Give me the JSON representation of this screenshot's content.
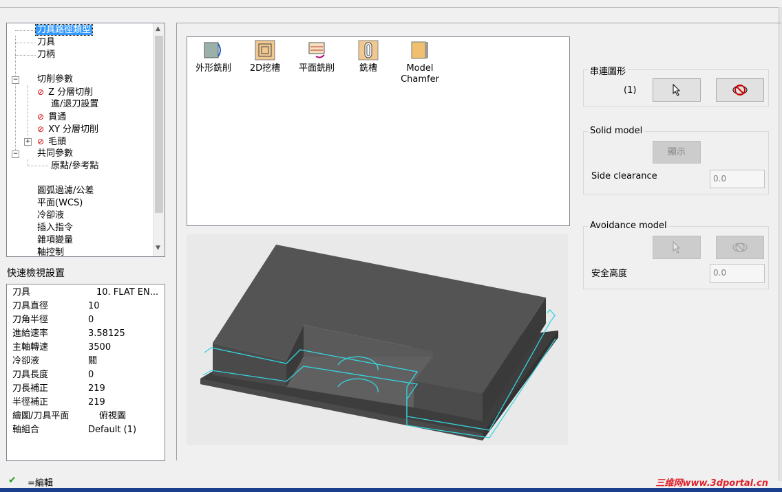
{
  "tree": {
    "items": [
      {
        "label": "刀具路徑類型",
        "selected": true
      },
      {
        "label": "刀具"
      },
      {
        "label": "刀柄"
      },
      {
        "label": "切削參數"
      },
      {
        "label": "Z 分層切削"
      },
      {
        "label": "進/退刀設置"
      },
      {
        "label": "貫通"
      },
      {
        "label": "XY 分層切削"
      },
      {
        "label": "毛頭"
      },
      {
        "label": "共同參數"
      },
      {
        "label": "原點/參考點"
      },
      {
        "label": "圓弧過濾/公差"
      },
      {
        "label": "平面(WCS)"
      },
      {
        "label": "冷卻液"
      },
      {
        "label": "插入指令"
      },
      {
        "label": "雜項變量"
      },
      {
        "label": "軸控制"
      }
    ]
  },
  "quick_view": {
    "title": "快速檢視設置",
    "rows": [
      {
        "key": "刀具",
        "value": "10. FLAT EN..."
      },
      {
        "key": "刀具直徑",
        "value": "10"
      },
      {
        "key": "刀角半徑",
        "value": "0"
      },
      {
        "key": "進給速率",
        "value": "3.58125"
      },
      {
        "key": "主軸轉速",
        "value": "3500"
      },
      {
        "key": "冷卻液",
        "value": "關"
      },
      {
        "key": "刀具長度",
        "value": "0"
      },
      {
        "key": "刀長補正",
        "value": "219"
      },
      {
        "key": "半徑補正",
        "value": "219"
      },
      {
        "key": "繪圖/刀具平面",
        "value": "俯視圖"
      },
      {
        "key": "軸組合",
        "value": "Default (1)"
      }
    ]
  },
  "toolpath_types": [
    {
      "label": "外形銑削",
      "icon": "contour-icon"
    },
    {
      "label": "2D挖槽",
      "icon": "pocket-icon"
    },
    {
      "label": "平面銑削",
      "icon": "facing-icon"
    },
    {
      "label": "銑槽",
      "icon": "slot-icon"
    },
    {
      "label": "Model\nChamfer",
      "icon": "chamfer-icon"
    }
  ],
  "chain": {
    "title": "串連圖形",
    "count": "(1)"
  },
  "solid_model": {
    "title": "Solid model",
    "show_label": "顯示",
    "side_clearance_label": "Side clearance",
    "side_clearance_value": "0.0"
  },
  "avoidance": {
    "title": "Avoidance model",
    "safe_height_label": "安全高度",
    "safe_height_value": "0.0"
  },
  "status": {
    "text": "=編輯"
  },
  "watermark": "三维网www.3dportal.cn",
  "colors": {
    "selection": "#3399ff",
    "toolpath": "#35d4e0",
    "disabled_icon": "#d00000",
    "bottom_bar": "#1a3f8c"
  }
}
